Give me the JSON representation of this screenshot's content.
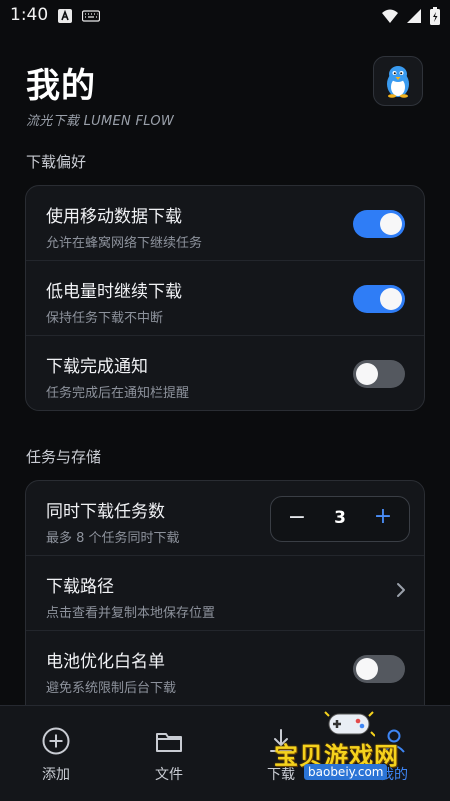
{
  "status_bar": {
    "time": "1:40"
  },
  "header": {
    "title": "我的",
    "subtitle": "流光下载  LUMEN FLOW"
  },
  "sections": {
    "download_prefs": {
      "title": "下载偏好",
      "items": [
        {
          "title": "使用移动数据下载",
          "subtitle": "允许在蜂窝网络下继续任务",
          "enabled": true
        },
        {
          "title": "低电量时继续下载",
          "subtitle": "保持任务下载不中断",
          "enabled": true
        },
        {
          "title": "下载完成通知",
          "subtitle": "任务完成后在通知栏提醒",
          "enabled": false
        }
      ]
    },
    "tasks_storage": {
      "title": "任务与存储",
      "concurrent": {
        "title": "同时下载任务数",
        "subtitle": "最多 8 个任务同时下载",
        "value": "3",
        "minus": "−",
        "plus": "+"
      },
      "path": {
        "title": "下载路径",
        "subtitle": "点击查看并复制本地保存位置"
      },
      "battery": {
        "title": "电池优化白名单",
        "subtitle": "避免系统限制后台下载",
        "enabled": false
      }
    }
  },
  "bottom_nav": {
    "items": [
      {
        "label": "添加",
        "icon": "plus-circle-icon"
      },
      {
        "label": "文件",
        "icon": "folder-icon"
      },
      {
        "label": "下载",
        "icon": "download-icon"
      },
      {
        "label": "我的",
        "icon": "person-icon",
        "active": true
      }
    ]
  },
  "watermark": {
    "text": "宝贝游戏网",
    "url": "baobeiy.com"
  },
  "colors": {
    "accent": "#2f7df6",
    "background": "#0b0c0e",
    "card": "#14161a"
  }
}
